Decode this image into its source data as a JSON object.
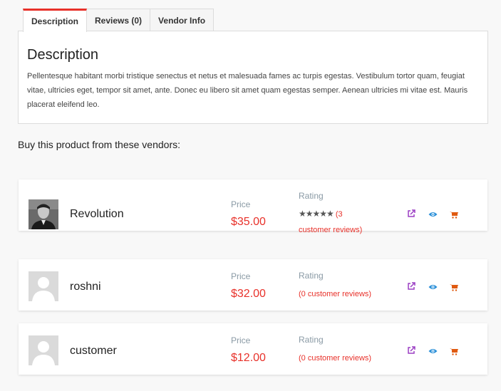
{
  "tabs": [
    {
      "label": "Description"
    },
    {
      "label": "Reviews (0)"
    },
    {
      "label": "Vendor Info"
    }
  ],
  "description": {
    "title": "Description",
    "text": "Pellentesque habitant morbi tristique senectus et netus et malesuada fames ac turpis egestas. Vestibulum tortor quam, feugiat vitae, ultricies eget, tempor sit amet, ante. Donec eu libero sit amet quam egestas semper. Aenean ultricies mi vitae est. Mauris placerat eleifend leo."
  },
  "buy_heading": "Buy this product from these vendors:",
  "labels": {
    "price": "Price",
    "rating": "Rating"
  },
  "vendors": [
    {
      "name": "Revolution",
      "price": "$35.00",
      "stars": "★★★★★",
      "reviews_a": "(3",
      "reviews_b": "customer reviews)"
    },
    {
      "name": "roshni",
      "price": "$32.00",
      "reviews": "(0 customer reviews)"
    },
    {
      "name": "customer",
      "price": "$12.00",
      "reviews": "(0 customer reviews)"
    }
  ],
  "colors": {
    "accent": "#e8312a",
    "link_icon": "#9b3fc4",
    "view_icon": "#2a8fd8",
    "cart_icon": "#e05a10"
  },
  "icons": [
    "external-link-icon",
    "eye-icon",
    "cart-icon"
  ]
}
